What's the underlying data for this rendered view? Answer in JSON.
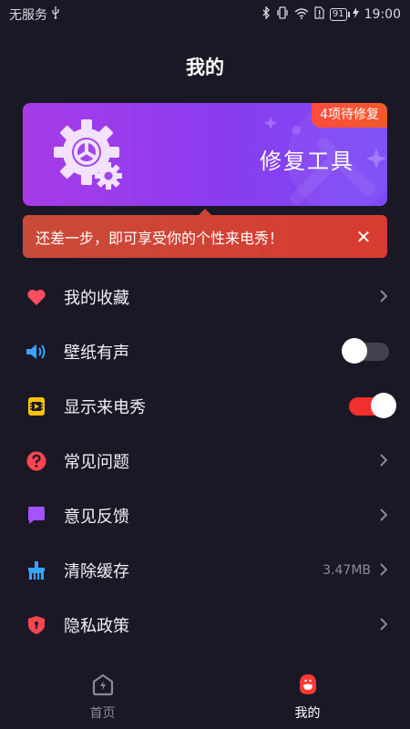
{
  "status_bar": {
    "carrier": "无服务",
    "battery": "91",
    "time": "19:00"
  },
  "header": {
    "title": "我的"
  },
  "repair_banner": {
    "badge": "4项待修复",
    "title": "修复工具"
  },
  "tip": {
    "text": "还差一步，即可享受你的个性来电秀！",
    "close": "✕"
  },
  "menu": [
    {
      "label": "我的收藏",
      "icon": "heart-icon",
      "color": "#ff4d5e"
    },
    {
      "label": "壁纸有声",
      "icon": "speaker-icon",
      "color": "#3aa3ff",
      "toggle": false
    },
    {
      "label": "显示来电秀",
      "icon": "call-show-icon",
      "color": "#ffc400",
      "toggle": true
    },
    {
      "label": "常见问题",
      "icon": "question-icon",
      "color": "#ff4550"
    },
    {
      "label": "意见反馈",
      "icon": "feedback-icon",
      "color": "#a552ff"
    },
    {
      "label": "清除缓存",
      "icon": "broom-icon",
      "color": "#3aa3ff",
      "value": "3.47MB"
    },
    {
      "label": "隐私政策",
      "icon": "shield-icon",
      "color": "#ff4550"
    }
  ],
  "tabs": [
    {
      "label": "首页",
      "icon": "home-bolt-icon",
      "active": false
    },
    {
      "label": "我的",
      "icon": "profile-icon",
      "active": true
    }
  ]
}
